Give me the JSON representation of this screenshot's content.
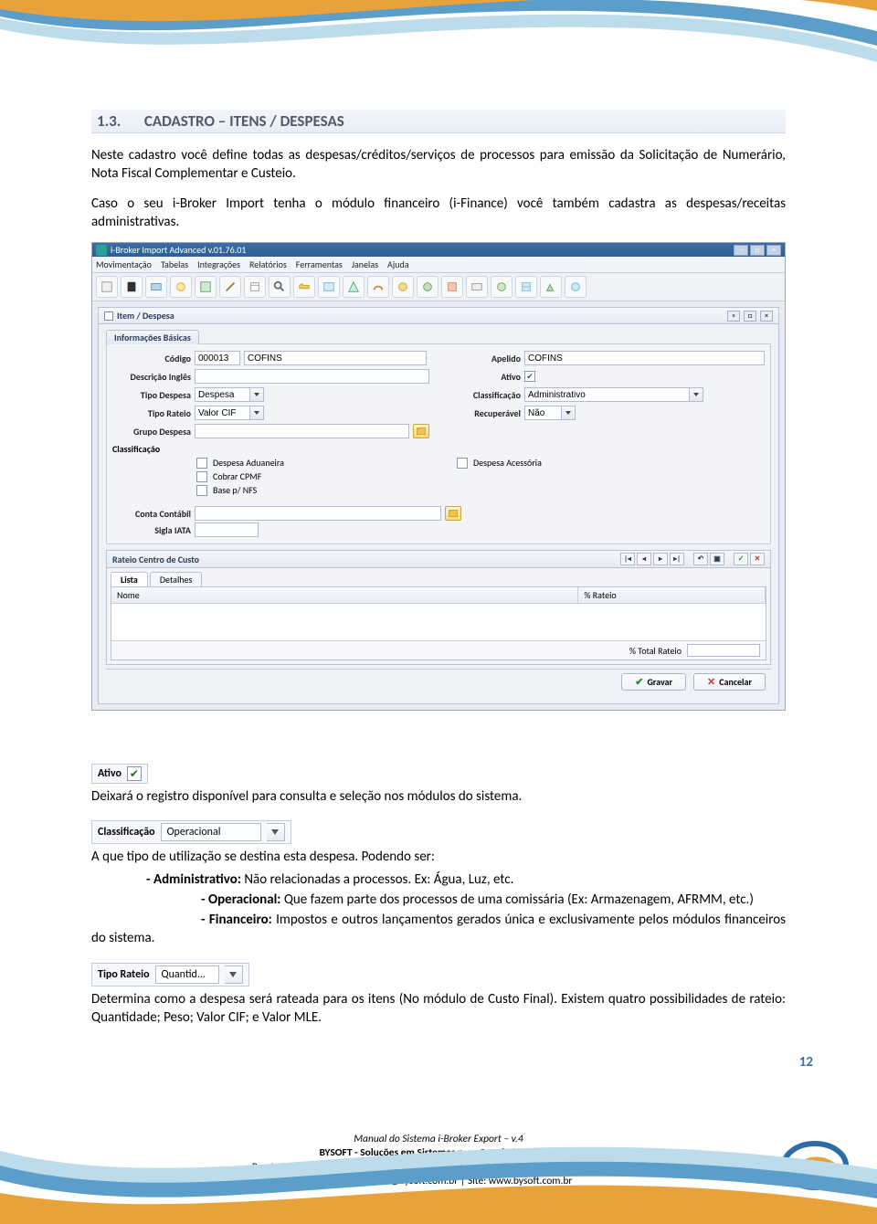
{
  "heading": {
    "number": "1.3.",
    "title": "CADASTRO – ITENS / DESPESAS"
  },
  "para1": "Neste cadastro você define todas as despesas/créditos/serviços de processos para emissão da Solicitação de Numerário, Nota Fiscal Complementar e Custeio.",
  "para2": "Caso o seu i-Broker Import tenha o módulo financeiro (i-Finance) você também cadastra as despesas/receitas administrativas.",
  "app": {
    "title": "i-Broker Import Advanced v.01.76.01",
    "menus": [
      "Movimentação",
      "Tabelas",
      "Integrações",
      "Relatórios",
      "Ferramentas",
      "Janelas",
      "Ajuda"
    ],
    "panel_title": "Item / Despesa",
    "section_tab": "Informações Básicas",
    "fields": {
      "codigo_label": "Código",
      "codigo_value": "000013",
      "codigo_desc": "COFINS",
      "apelido_label": "Apelido",
      "apelido_value": "COFINS",
      "desc_ingles_label": "Descrição Inglês",
      "ativo_label": "Ativo",
      "tipo_despesa_label": "Tipo Despesa",
      "tipo_despesa_value": "Despesa",
      "classif_label": "Classificação",
      "classif_value": "Administrativo",
      "tipo_rateio_label": "Tipo Rateio",
      "tipo_rateio_value": "Valor CIF",
      "recup_label": "Recuperável",
      "recup_value": "Não",
      "grupo_label": "Grupo Despesa",
      "class_section": "Classificação",
      "chk_aduaneira": "Despesa Aduaneira",
      "chk_cpmf": "Cobrar CPMF",
      "chk_nfs": "Base p/ NFS",
      "chk_acess": "Despesa Acessória",
      "conta_label": "Conta Contábil",
      "sigla_label": "Sigla IATA"
    },
    "rateio": {
      "title": "Rateio Centro de Custo",
      "tab_list": "Lista",
      "tab_detail": "Detalhes",
      "col_nome": "Nome",
      "col_rateio": "% Rateio",
      "total_label": "% Total Rateio"
    },
    "buttons": {
      "save": "Gravar",
      "cancel": "Cancelar"
    }
  },
  "snippet_ativo": {
    "label": "Ativo"
  },
  "para_ativo": "Deixará o registro disponível para consulta e seleção nos módulos do sistema.",
  "snippet_classif": {
    "label": "Classificação",
    "value": "Operacional"
  },
  "para_classif_intro": "A que tipo de utilização se destina esta despesa. Podendo ser:",
  "bullet_admin_b": "- Administrativo: ",
  "bullet_admin_t": "Não relacionadas a processos. Ex: Água, Luz, etc.",
  "bullet_oper_b": "- Operacional: ",
  "bullet_oper_t": "Que fazem parte dos processos de uma comissária (Ex: Armazenagem, AFRMM, etc.)",
  "bullet_fin_b": "- Financeiro: ",
  "bullet_fin_t": "Impostos e outros lançamentos gerados única e exclusivamente pelos módulos financeiros do sistema.",
  "snippet_rateio": {
    "label": "Tipo Rateio",
    "value": "Quantid..."
  },
  "para_rateio": "Determina como a despesa será rateada para os itens (No módulo de Custo Final). Existem quatro possibilidades de rateio: Quantidade; Peso; Valor CIF; e Valor MLE.",
  "page_number": "12",
  "footer": {
    "l1": "Manual do Sistema i-Broker Export – v.4",
    "l2": "BYSOFT - Soluções em Sistemas para Comércio Exterior",
    "l3": "Rua Muniz de Sousa, 591 – Aclimação – São Paulo – CEP 01534-000 | +55 11 3585-6000",
    "l4": "E-mail: treinamento@bysoft.com.br | Site: www.bysoft.com.br"
  }
}
